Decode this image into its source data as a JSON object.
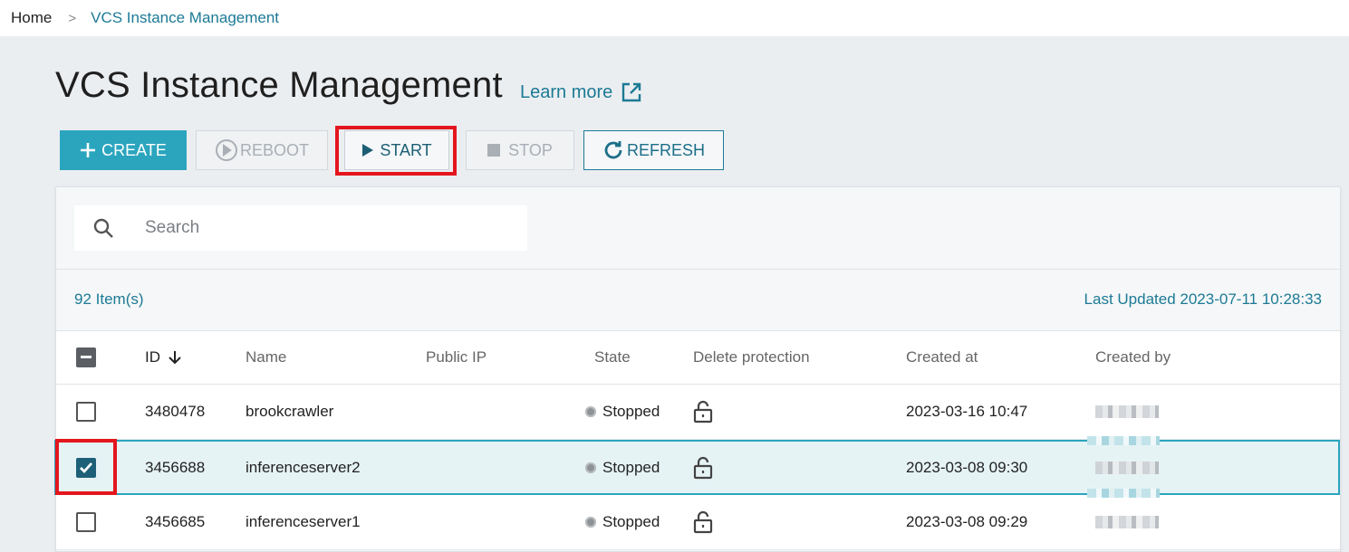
{
  "breadcrumb": {
    "home": "Home",
    "separator": ">",
    "current": "VCS Instance Management"
  },
  "page": {
    "title": "VCS Instance Management",
    "learn_more": "Learn more"
  },
  "toolbar": {
    "create": "CREATE",
    "reboot": "REBOOT",
    "start": "START",
    "stop": "STOP",
    "refresh": "REFRESH"
  },
  "search": {
    "placeholder": "Search"
  },
  "summary": {
    "item_count": "92 Item(s)",
    "last_updated": "Last Updated 2023-07-11 10:28:33"
  },
  "table": {
    "headers": {
      "id": "ID",
      "name": "Name",
      "public_ip": "Public IP",
      "state": "State",
      "delete_protection": "Delete protection",
      "created_at": "Created at",
      "created_by": "Created by"
    },
    "rows": [
      {
        "id": "3480478",
        "name": "brookcrawler",
        "public_ip": "",
        "state": "Stopped",
        "created_at": "2023-03-16 10:47",
        "checked": false
      },
      {
        "id": "3456688",
        "name": "inferenceserver2",
        "public_ip": "",
        "state": "Stopped",
        "created_at": "2023-03-08 09:30",
        "checked": true
      },
      {
        "id": "3456685",
        "name": "inferenceserver1",
        "public_ip": "",
        "state": "Stopped",
        "created_at": "2023-03-08 09:29",
        "checked": false
      }
    ]
  },
  "colors": {
    "accent": "#2ba5be",
    "link": "#1c7a95",
    "highlight": "#e3161e",
    "selected_row": "#e6f3f5"
  },
  "icons": {
    "create": "plus-icon",
    "reboot": "play-circle-icon",
    "start": "play-icon",
    "stop": "stop-square-icon",
    "refresh": "refresh-icon",
    "learn_more": "external-link-icon",
    "search": "search-icon",
    "sort": "arrow-down-icon",
    "delete_protection": "unlock-icon"
  }
}
